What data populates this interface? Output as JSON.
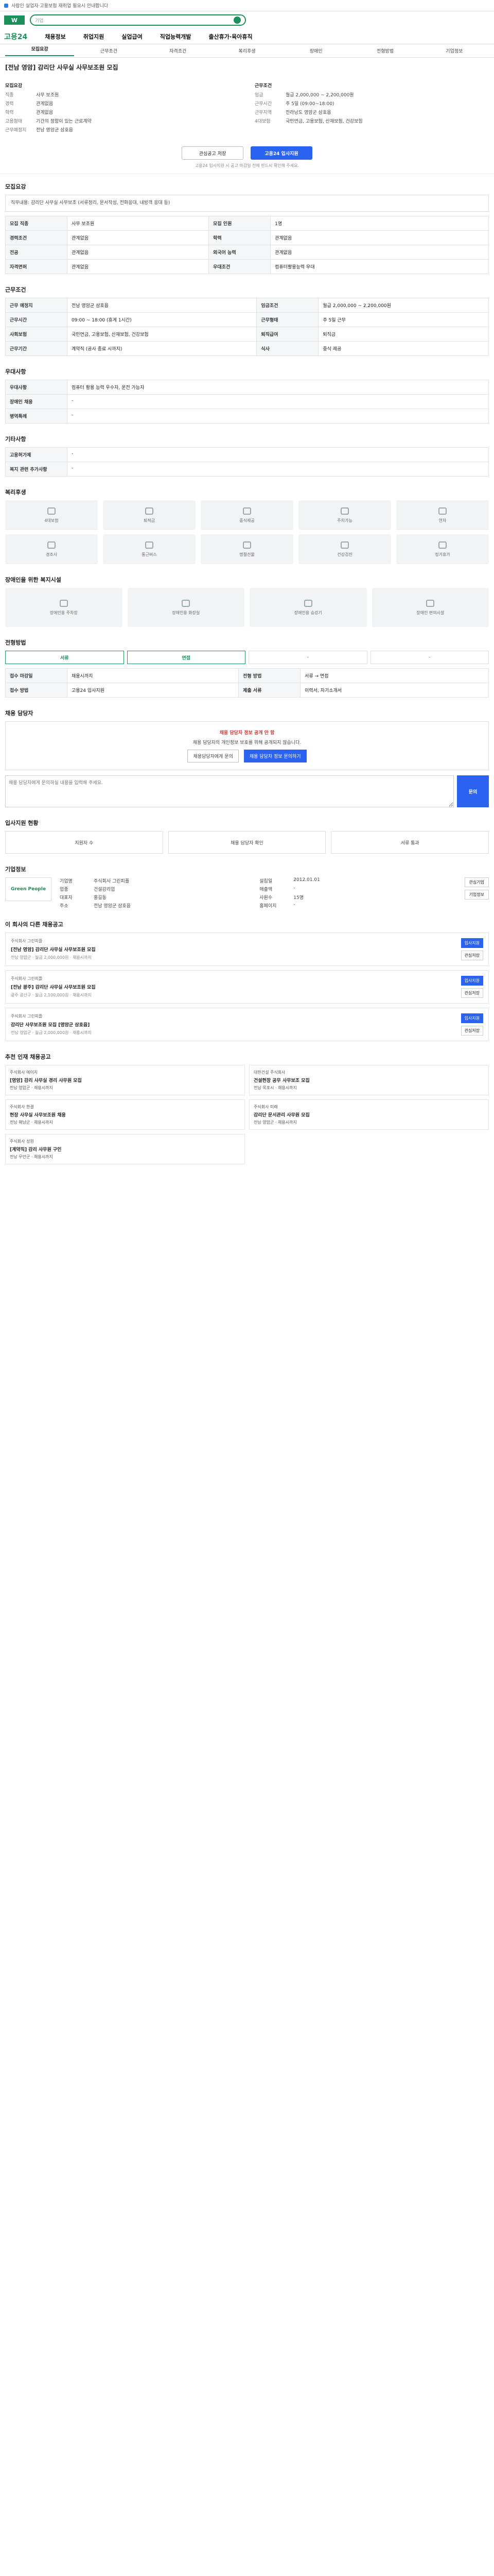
{
  "topbar": {
    "text": "사람인 실업자·고용보험 재취업 필요시 안내합니다"
  },
  "search": {
    "placeholder": "기업"
  },
  "gnb": {
    "brand": "고용24",
    "items": [
      "채용정보",
      "취업지원",
      "실업급여",
      "직업능력개발",
      "출산휴가·육아휴직"
    ]
  },
  "tabs": [
    "모집요강",
    "근무조건",
    "자격조건",
    "복리후생",
    "장애인",
    "전형방법",
    "기업정보"
  ],
  "job": {
    "title": "[전남 영암] 감리단 사무실 사무보조원 모집",
    "left_label": "모집요강",
    "right_label": "근무조건",
    "left_kv": [
      [
        "직종",
        "사무 보조원"
      ],
      [
        "경력",
        "관계없음"
      ],
      [
        "학력",
        "관계없음"
      ],
      [
        "고용형태",
        "기간의 정함이 있는 근로계약"
      ],
      [
        "근무예정지",
        "전남 영암군 삼호읍"
      ]
    ],
    "right_kv": [
      [
        "임금",
        "월급 2,000,000 ~ 2,200,000원"
      ],
      [
        "근무시간",
        "주 5일 (09:00~18:00)"
      ],
      [
        "근무지역",
        "전라남도 영암군 삼호읍"
      ],
      [
        "4대보험",
        "국민연금, 고용보험, 산재보험, 건강보험"
      ]
    ]
  },
  "buttons": {
    "scrap": "관심공고 저장",
    "apply": "고용24 입사지원"
  },
  "notice": "고용24 입사지원 시 공고 마감일 전에 반드시 확인해 주세요.",
  "sections": {
    "recruit": "모집요강",
    "work": "근무조건",
    "qual": "우대사항",
    "etc": "기타사항",
    "welfare": "복리후생",
    "disabled": "장애인을 위한 복지시설",
    "procedure": "전형방법",
    "manager": "채용 담당자",
    "qa": "입사지원 현황",
    "info": "인증기업 정보",
    "company": "기업정보",
    "similar": "이 회사의 다른 채용공고",
    "recommend": "추천 인재 채용공고"
  },
  "recruit": {
    "duties": "직무내용: 감리단 사무실 사무보조 (서류정리, 문서작성, 전화응대, 내방객 응대 등)",
    "rows": [
      [
        "모집 직종",
        "사무 보조원"
      ],
      [
        "모집 인원",
        "1명"
      ],
      [
        "경력조건",
        "관계없음"
      ],
      [
        "학력",
        "관계없음"
      ],
      [
        "전공",
        "관계없음"
      ],
      [
        "외국어 능력",
        "관계없음"
      ],
      [
        "자격면허",
        "관계없음"
      ],
      [
        "우대조건",
        "컴퓨터활용능력 우대"
      ]
    ]
  },
  "work": {
    "rows": [
      [
        "근무 예정지",
        "전남 영암군 삼호읍"
      ],
      [
        "임금조건",
        "월급 2,000,000 ~ 2,200,000원"
      ],
      [
        "근무시간",
        "09:00 ~ 18:00 (휴게 1시간)"
      ],
      [
        "근무형태",
        "주 5일 근무"
      ],
      [
        "사회보험",
        "국민연금, 고용보험, 산재보험, 건강보험"
      ],
      [
        "퇴직급여",
        "퇴직금"
      ],
      [
        "근무기간",
        "계약직 (공사 종료 시까지)"
      ],
      [
        "식사",
        "중식 제공"
      ]
    ]
  },
  "qual_rows": [
    [
      "우대사항",
      "컴퓨터 활용 능력 우수자, 운전 가능자"
    ],
    [
      "장애인 채용",
      "-"
    ],
    [
      "병역특례",
      "-"
    ]
  ],
  "etc_rows": [
    [
      "고용허가제",
      "-"
    ],
    [
      "복지 관련 추가사항",
      "-"
    ]
  ],
  "welfare": [
    "4대보험",
    "퇴직금",
    "중식제공",
    "주차가능",
    "연차",
    "경조사",
    "통근버스",
    "명절선물",
    "건강검진",
    "정기휴가"
  ],
  "disabled_cards": [
    "장애인용 주차장",
    "장애인용 화장실",
    "장애인용 승강기",
    "장애인 편의시설"
  ],
  "procedure": {
    "steps": [
      "서류",
      "면접",
      "-",
      "-"
    ],
    "rows": [
      [
        "접수 마감일",
        "채용시까지"
      ],
      [
        "전형 방법",
        "서류 → 면접"
      ],
      [
        "접수 방법",
        "고용24 입사지원"
      ],
      [
        "제출 서류",
        "이력서, 자기소개서"
      ]
    ]
  },
  "manager": {
    "warn": "채용 담당자 정보 공개 안 함",
    "text": "채용 담당자의 개인정보 보호를 위해 공개되지 않습니다.",
    "btn1": "채용담당자에게 문의",
    "btn2": "채용 담당자 정보 문의하기"
  },
  "qa": {
    "placeholder": "채용 담당자에게 문의하실 내용을 입력해 주세요.",
    "send": "문의",
    "stats": [
      "지원자 수",
      "채용 담당자 확인",
      "서류 통과"
    ]
  },
  "company": {
    "logo": "Green People",
    "rows": [
      [
        "기업명",
        "주식회사 그린피플"
      ],
      [
        "설립일",
        "2012.01.01"
      ],
      [
        "업종",
        "건설감리업"
      ],
      [
        "매출액",
        "-"
      ],
      [
        "대표자",
        "홍길동"
      ],
      [
        "사원수",
        "15명"
      ],
      [
        "주소",
        "전남 영암군 삼호읍"
      ],
      [
        "홈페이지",
        "-"
      ]
    ],
    "btns": [
      "관심기업",
      "기업정보"
    ]
  },
  "similar": [
    {
      "co": "주식회사 그린피플",
      "t": "[전남 영암] 감리단 사무실 사무보조원 모집",
      "m": "전남 영암군 · 월급 2,000,000원 · 채용시까지"
    },
    {
      "co": "주식회사 그린피플",
      "t": "[전남 광주] 감리단 사무실 사무보조원 모집",
      "m": "광주 광산구 · 월급 2,100,000원 · 채용시까지"
    },
    {
      "co": "주식회사 그린피플",
      "t": "감리단 사무보조원 모집 [영암군 삼호읍]",
      "m": "전남 영암군 · 월급 2,000,000원 · 채용시까지"
    }
  ],
  "similar_btns": [
    "입사지원",
    "관심저장"
  ],
  "recommend": [
    {
      "co": "주식회사 에이치",
      "t": "[영암] 감리 사무실 경리 사무원 모집",
      "m": "전남 영암군 · 채용시까지"
    },
    {
      "co": "대한건설 주식회사",
      "t": "건설현장 공무 사무보조 모집",
      "m": "전남 목포시 · 채용시까지"
    },
    {
      "co": "주식회사 한결",
      "t": "현장 사무실 사무보조원 채용",
      "m": "전남 해남군 · 채용시까지"
    },
    {
      "co": "주식회사 미래",
      "t": "감리단 문서관리 사무원 모집",
      "m": "전남 영암군 · 채용시까지"
    },
    {
      "co": "주식회사 성원",
      "t": "[계약직] 감리 사무원 구인",
      "m": "전남 무안군 · 채용시까지"
    }
  ]
}
